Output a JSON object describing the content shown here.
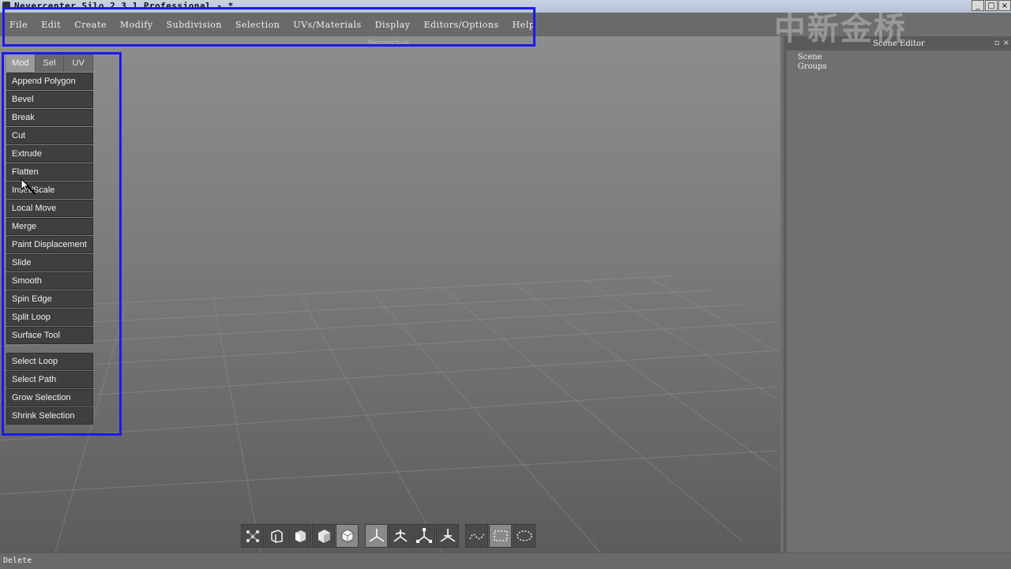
{
  "window": {
    "title": "Nevercenter Silo 2.3.1 Professional - *",
    "buttons": [
      "_",
      "□",
      "×"
    ]
  },
  "watermark": "中新金桥",
  "menubar": {
    "items": [
      "File",
      "Edit",
      "Create",
      "Modify",
      "Subdivision",
      "Selection",
      "UVs/Materials",
      "Display",
      "Editors/Options",
      "Help"
    ]
  },
  "viewport": {
    "label": "Perspective"
  },
  "sidepanel": {
    "tabs": [
      "Mod",
      "Sel",
      "UV"
    ],
    "active_tab": "Mod",
    "tools": [
      "Append Polygon",
      "Bevel",
      "Break",
      "Cut",
      "Extrude",
      "Flatten",
      "Inset/Scale",
      "Local Move",
      "Merge",
      "Paint Displacement",
      "Slide",
      "Smooth",
      "Spin Edge",
      "Split Loop",
      "Surface Tool"
    ],
    "selection_tools": [
      "Select Loop",
      "Select Path",
      "Grow Selection",
      "Shrink Selection"
    ]
  },
  "bottom_toolbar": {
    "groups": [
      [
        "vertex-mode-icon",
        "edge-mode-icon",
        "face-mode-icon",
        "object-mode-icon",
        "smart-select-icon"
      ],
      [
        "move-manipulator-icon",
        "rotate-manipulator-icon",
        "scale-manipulator-icon",
        "universal-manipulator-icon"
      ],
      [
        "lasso-select-icon",
        "rect-select-icon",
        "paint-select-icon"
      ]
    ],
    "active": [
      "smart-select-icon",
      "move-manipulator-icon",
      "rect-select-icon"
    ]
  },
  "scene_editor": {
    "title": "Scene Editor",
    "items": [
      "Scene",
      "Groups"
    ]
  },
  "status": {
    "text": "Delete"
  },
  "colors": {
    "highlight": "#1a1aee"
  }
}
